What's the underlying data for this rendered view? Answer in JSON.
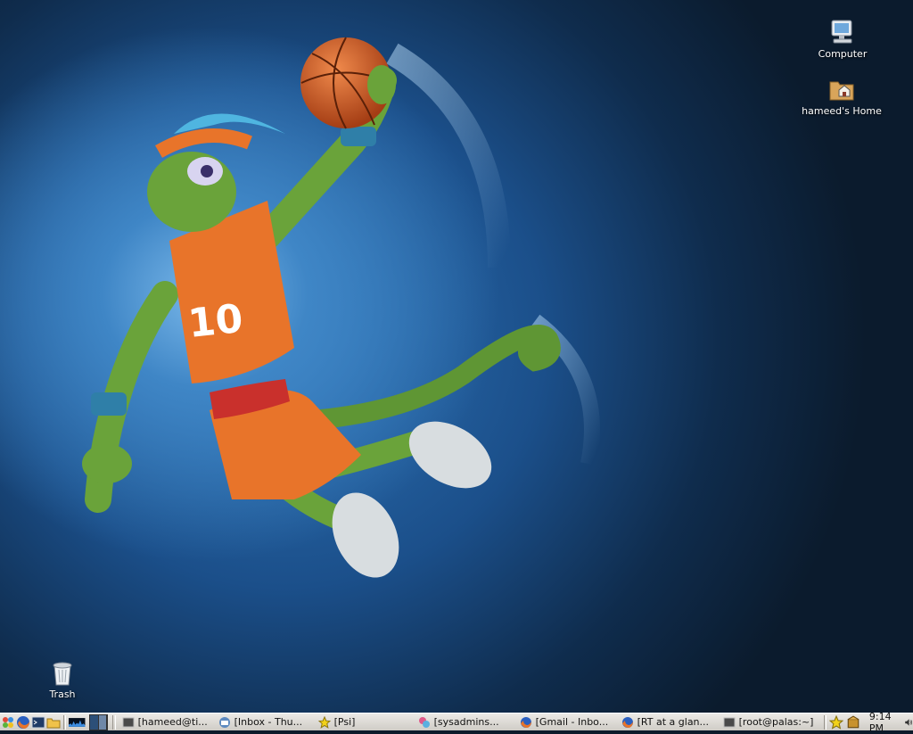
{
  "desktop": {
    "icons": [
      {
        "label": "Computer",
        "icon": "computer-icon"
      },
      {
        "label": "hameed's Home",
        "icon": "home-folder-icon"
      },
      {
        "label": "Trash",
        "icon": "trash-icon"
      }
    ],
    "wallpaper": {
      "jersey_number": "10",
      "colors": {
        "background": "#1b4f8a",
        "jersey": "#e8742a",
        "gecko": "#6aa33a"
      }
    }
  },
  "panel": {
    "launchers": [
      "suse-menu-icon",
      "firefox-icon",
      "terminal-icon",
      "folder-icon"
    ],
    "tasks": [
      {
        "label": "[hameed@ti...",
        "icon": "terminal-icon"
      },
      {
        "label": "[Inbox - Thu...",
        "icon": "mail-icon"
      },
      {
        "label": "[Psi]",
        "icon": "star-icon"
      },
      {
        "label": "[sysadmins...",
        "icon": "chat-icon"
      },
      {
        "label": "[Gmail - Inbo...",
        "icon": "firefox-icon"
      },
      {
        "label": "[RT at a glan...",
        "icon": "firefox-icon"
      },
      {
        "label": "[root@palas:~]",
        "icon": "terminal-icon"
      }
    ],
    "clock": "9:14 PM"
  }
}
